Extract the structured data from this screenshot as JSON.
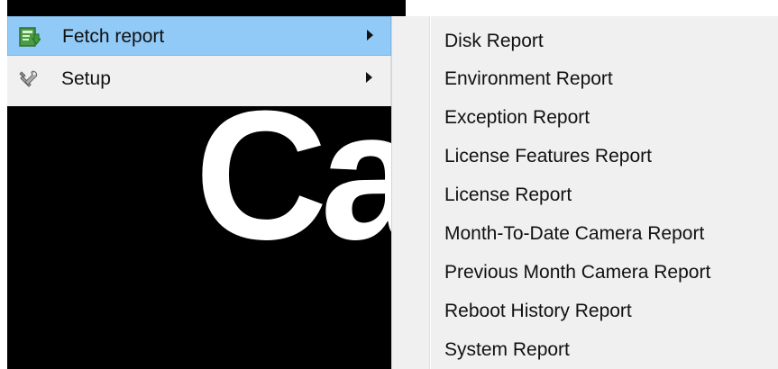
{
  "background": {
    "logo_text": "Ca"
  },
  "main_menu": {
    "items": [
      {
        "label": "Fetch report",
        "icon": "report-download-icon",
        "active": true,
        "has_submenu": true
      },
      {
        "label": "Setup",
        "icon": "tools-icon",
        "active": false,
        "has_submenu": true
      }
    ]
  },
  "submenu": {
    "items": [
      {
        "label": "Disk Report"
      },
      {
        "label": "Environment Report"
      },
      {
        "label": "Exception Report"
      },
      {
        "label": "License Features Report"
      },
      {
        "label": "License Report"
      },
      {
        "label": "Month-To-Date Camera Report"
      },
      {
        "label": "Previous Month Camera Report"
      },
      {
        "label": "Reboot History Report"
      },
      {
        "label": "System Report"
      }
    ]
  },
  "colors": {
    "menu_bg": "#f0f0f0",
    "highlight": "#91c9f7",
    "black_area": "#000000"
  }
}
